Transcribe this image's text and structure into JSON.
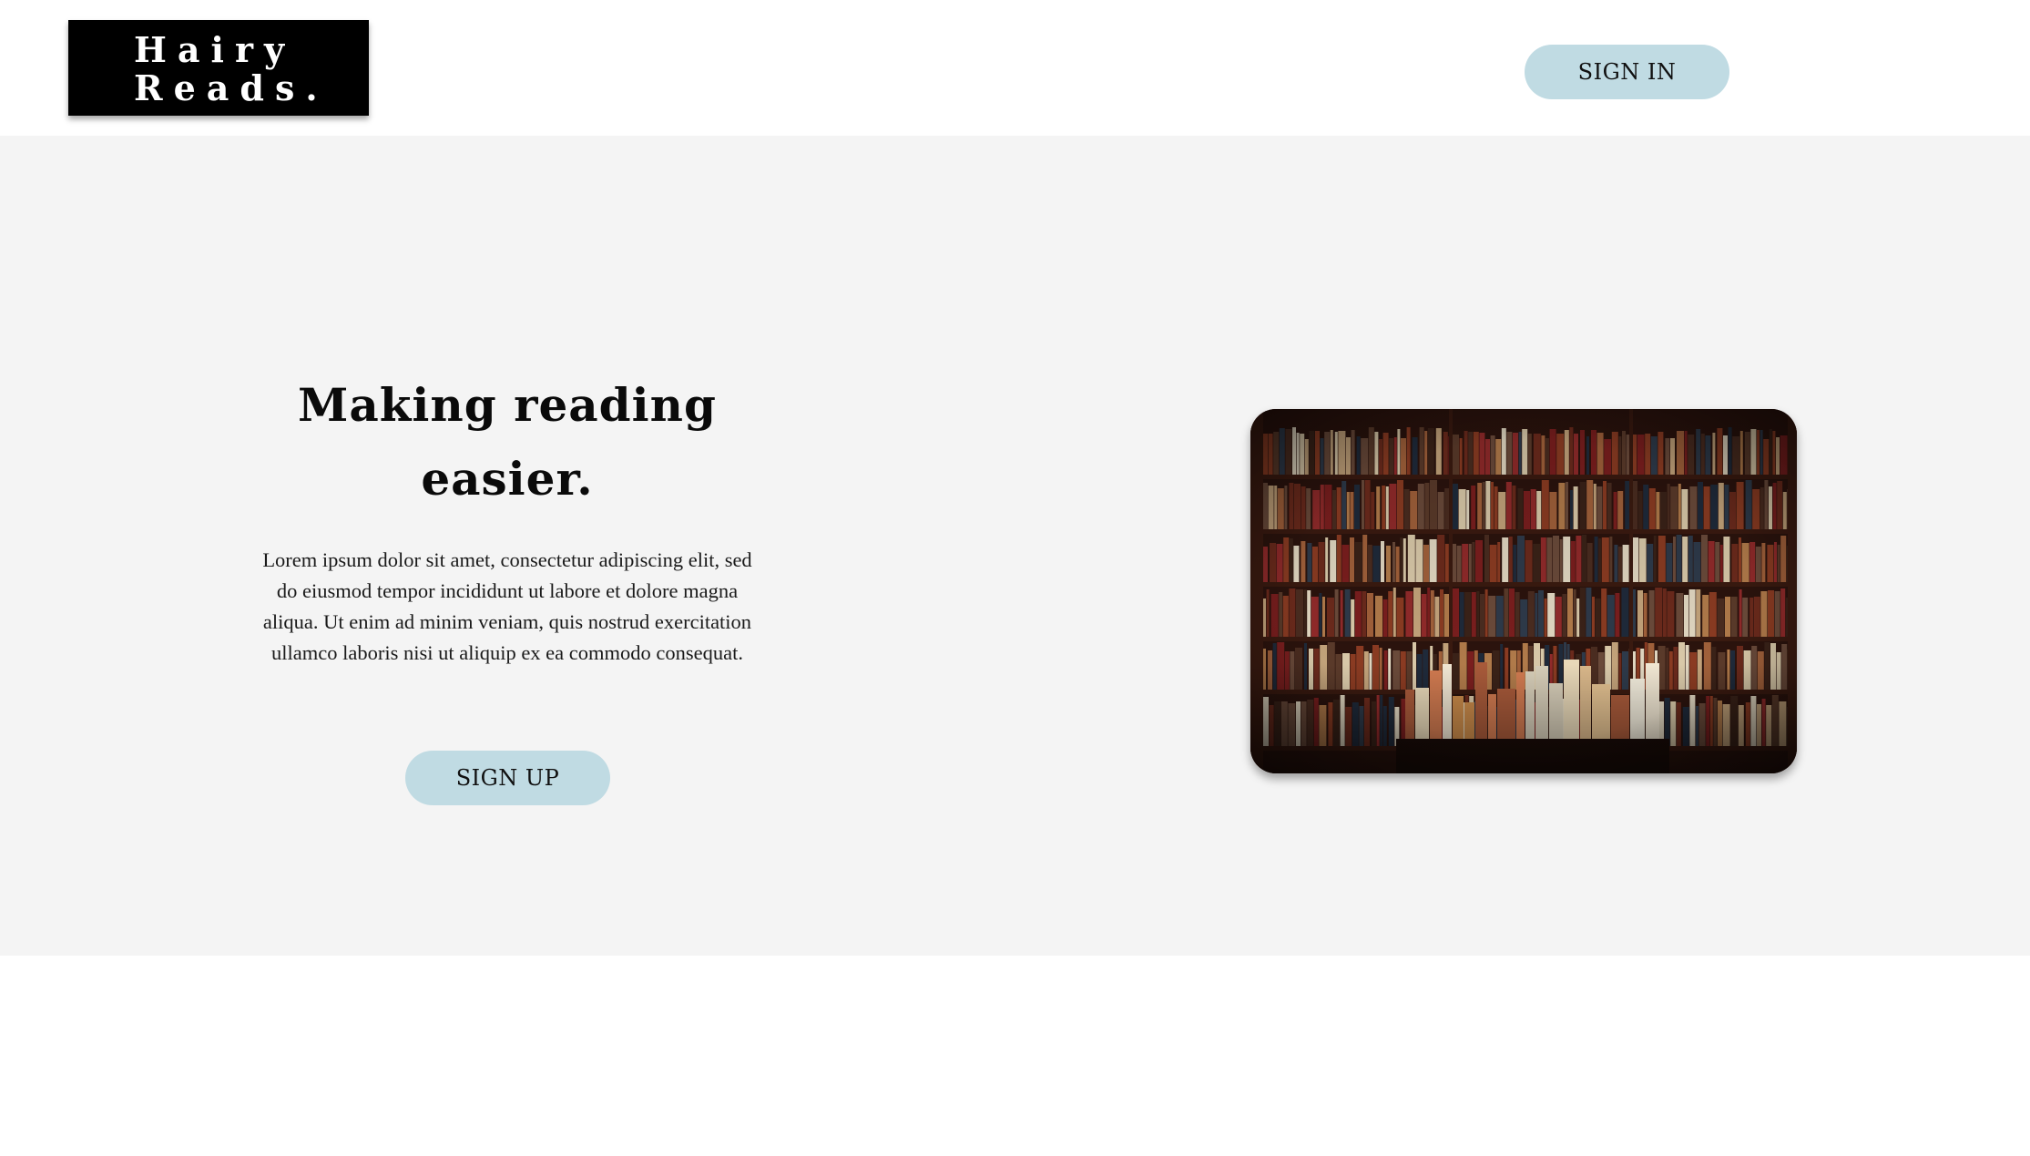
{
  "header": {
    "logo_line1": "Hairy",
    "logo_line2": "Reads.",
    "signin_label": "SIGN IN"
  },
  "hero": {
    "title": "Making reading easier.",
    "description": "Lorem ipsum dolor sit amet, consectetur adipiscing elit, sed do eiusmod tempor incididunt ut labore et dolore magna aliqua. Ut enim ad minim veniam, quis nostrud exercitation ullamco laboris nisi ut aliquip ex ea commodo consequat.",
    "signup_label": "SIGN UP"
  },
  "colors": {
    "button_bg": "#c0dbe3",
    "hero_bg": "#f4f4f4",
    "logo_bg": "#000000"
  }
}
